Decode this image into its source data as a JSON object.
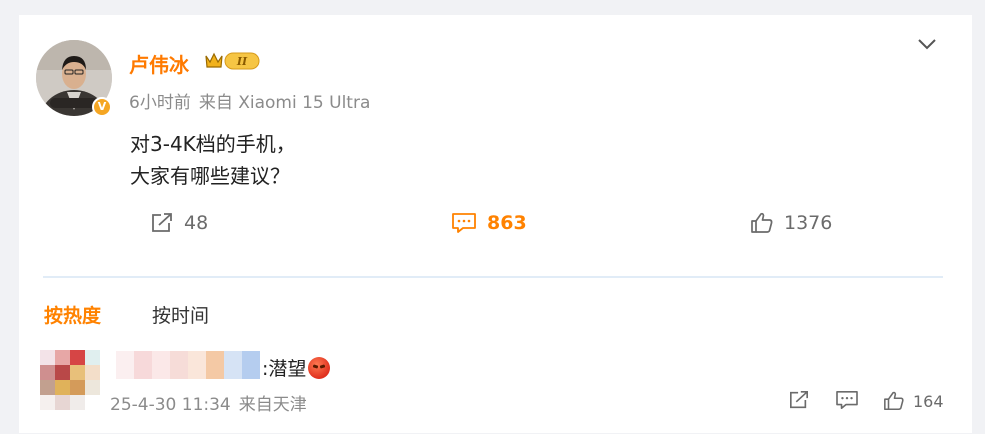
{
  "post": {
    "author": "卢伟冰",
    "level_badge": "II",
    "time": "6小时前",
    "source": "来自 Xiaomi 15 Ultra",
    "text_lines": [
      "对3-4K档的手机，",
      "大家有哪些建议？"
    ],
    "verified_badge": "V",
    "actions": {
      "repost_count": "48",
      "comment_count": "863",
      "like_count": "1376"
    }
  },
  "comments": {
    "sort_tabs": [
      {
        "label": "按热度",
        "active": true
      },
      {
        "label": "按时间",
        "active": false
      }
    ],
    "items": [
      {
        "text": ":潜望",
        "emoji": "angry-face-emoji",
        "time": "25-4-30 11:34",
        "source": "来自天津",
        "like_count": "164"
      }
    ]
  },
  "icons": {
    "collapse": "chevron-down-icon",
    "repost": "repost-icon",
    "comment": "comment-icon",
    "like": "thumbs-up-icon"
  },
  "colors": {
    "accent": "#ff8200",
    "name": "#ff7a00",
    "muted": "#8b8b8b",
    "divider": "#e1ecf7"
  }
}
